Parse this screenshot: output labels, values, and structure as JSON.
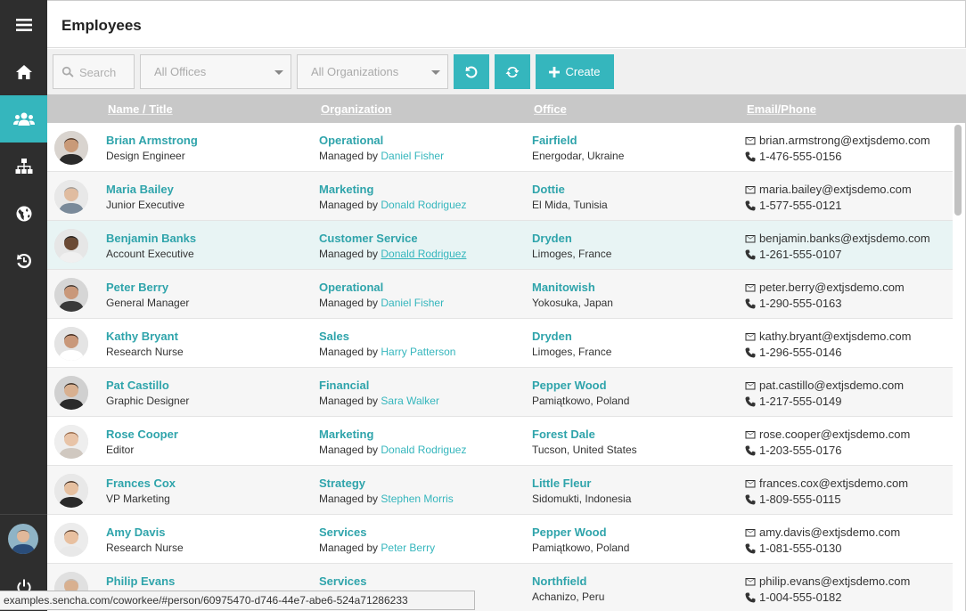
{
  "app": {
    "page_title": "Employees",
    "status_url": "examples.sencha.com/coworkee/#person/60975470-d746-44e7-abe6-524a71286233"
  },
  "sidebar": {
    "items": [
      {
        "icon": "hamburger-menu-icon"
      },
      {
        "icon": "home-icon"
      },
      {
        "icon": "users-icon",
        "active": true
      },
      {
        "icon": "org-chart-icon"
      },
      {
        "icon": "globe-icon"
      },
      {
        "icon": "history-icon"
      }
    ],
    "bottom": [
      {
        "icon": "user-avatar"
      },
      {
        "icon": "power-icon"
      }
    ]
  },
  "toolbar": {
    "search_placeholder": "Search",
    "offices_value": "All Offices",
    "organizations_value": "All Organizations",
    "create_label": "Create"
  },
  "grid": {
    "columns": [
      "Name / Title",
      "Organization",
      "Office",
      "Email/Phone"
    ],
    "managed_by_prefix": "Managed by ",
    "rows": [
      {
        "name": "Brian Armstrong",
        "title": "Design Engineer",
        "org": "Operational",
        "manager": "Daniel Fisher",
        "office": "Fairfield",
        "location": "Energodar, Ukraine",
        "email": "brian.armstrong@extjsdemo.com",
        "phone": "1-476-555-0156"
      },
      {
        "name": "Maria Bailey",
        "title": "Junior Executive",
        "org": "Marketing",
        "manager": "Donald Rodriguez",
        "office": "Dottie",
        "location": "El Mida, Tunisia",
        "email": "maria.bailey@extjsdemo.com",
        "phone": "1-577-555-0121"
      },
      {
        "name": "Benjamin Banks",
        "title": "Account Executive",
        "org": "Customer Service",
        "manager": "Donald Rodriguez",
        "office": "Dryden",
        "location": "Limoges, France",
        "email": "benjamin.banks@extjsdemo.com",
        "phone": "1-261-555-0107"
      },
      {
        "name": "Peter Berry",
        "title": "General Manager",
        "org": "Operational",
        "manager": "Daniel Fisher",
        "office": "Manitowish",
        "location": "Yokosuka, Japan",
        "email": "peter.berry@extjsdemo.com",
        "phone": "1-290-555-0163"
      },
      {
        "name": "Kathy Bryant",
        "title": "Research Nurse",
        "org": "Sales",
        "manager": "Harry Patterson",
        "office": "Dryden",
        "location": "Limoges, France",
        "email": "kathy.bryant@extjsdemo.com",
        "phone": "1-296-555-0146"
      },
      {
        "name": "Pat Castillo",
        "title": "Graphic Designer",
        "org": "Financial",
        "manager": "Sara Walker",
        "office": "Pepper Wood",
        "location": "Pamiątkowo, Poland",
        "email": "pat.castillo@extjsdemo.com",
        "phone": "1-217-555-0149"
      },
      {
        "name": "Rose Cooper",
        "title": "Editor",
        "org": "Marketing",
        "manager": "Donald Rodriguez",
        "office": "Forest Dale",
        "location": "Tucson, United States",
        "email": "rose.cooper@extjsdemo.com",
        "phone": "1-203-555-0176"
      },
      {
        "name": "Frances Cox",
        "title": "VP Marketing",
        "org": "Strategy",
        "manager": "Stephen Morris",
        "office": "Little Fleur",
        "location": "Sidomukti, Indonesia",
        "email": "frances.cox@extjsdemo.com",
        "phone": "1-809-555-0115"
      },
      {
        "name": "Amy Davis",
        "title": "Research Nurse",
        "org": "Services",
        "manager": "Peter Berry",
        "office": "Pepper Wood",
        "location": "Pamiątkowo, Poland",
        "email": "amy.davis@extjsdemo.com",
        "phone": "1-081-555-0130"
      },
      {
        "name": "Philip Evans",
        "title": "",
        "org": "Services",
        "manager": "",
        "office": "Northfield",
        "location": "Achanizo, Peru",
        "email": "philip.evans@extjsdemo.com",
        "phone": "1-004-555-0182"
      }
    ]
  },
  "colors": {
    "accent": "#35b6bd",
    "sidebar": "#2e2e2e",
    "link": "#2fa4ab"
  }
}
